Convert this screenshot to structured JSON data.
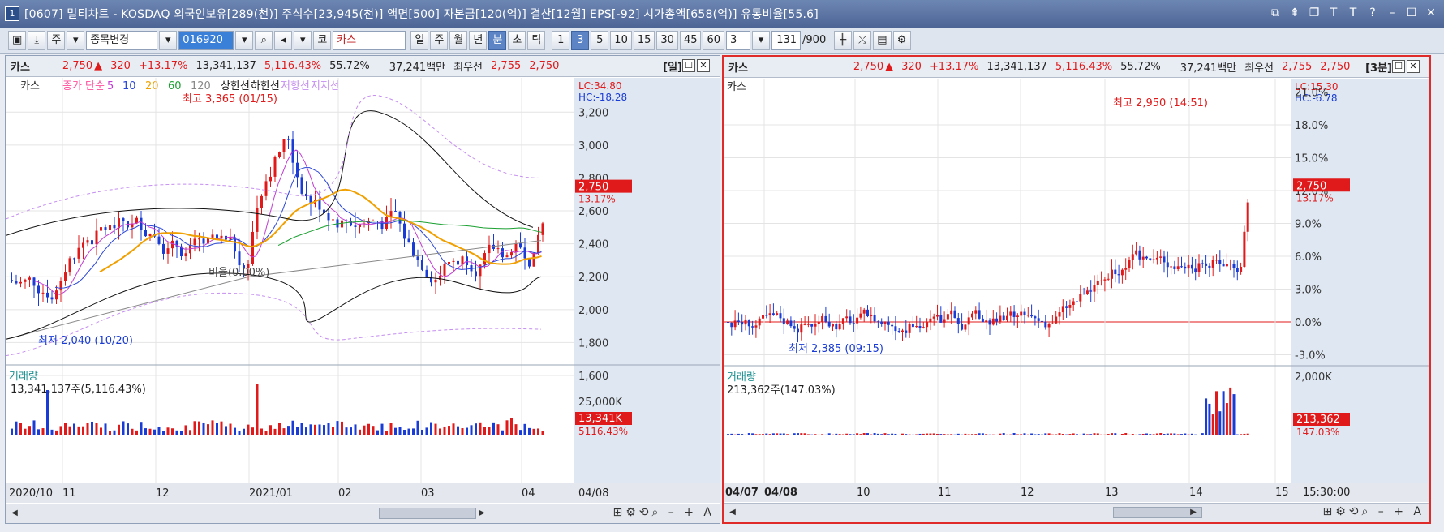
{
  "window": {
    "app_index": "1",
    "title": "[0607] 멀티차트 - KOSDAQ 외국인보유[289(천)] 주식수[23,945(천)] 액면[500] 자본금[120(억)] 결산[12월] EPS[-92] 시가총액[658(억)] 유통비율[55.6]"
  },
  "toolbar": {
    "market": "주",
    "stock_change": "종목변경",
    "code": "016920",
    "kor_btn": "코",
    "stock_name": "카스",
    "periods": [
      "일",
      "주",
      "월",
      "년",
      "분",
      "초",
      "틱"
    ],
    "active_period": "분",
    "intervals": [
      "1",
      "3",
      "5",
      "10",
      "15",
      "30",
      "45",
      "60"
    ],
    "active_interval": "3",
    "interval_value": "3",
    "count": "131",
    "count_max": "/900"
  },
  "left_panel": {
    "name": "카스",
    "price": "2,750",
    "change": "320",
    "change_pct": "+13.17%",
    "volume": "13,341,137",
    "volume_ratio": "5,116.43%",
    "rotation": "55.72%",
    "amount": "37,241백만",
    "best_label": "최우선",
    "ask": "2,755",
    "bid": "2,750",
    "period": "[일]",
    "legend_tag": "카스",
    "legend_items": [
      "종가 단순",
      "5",
      "10",
      "20",
      "60",
      "120",
      "상한선",
      "하한선",
      "저항선",
      "지지선"
    ],
    "lc": "LC:34.80",
    "hc": "HC:-18.28",
    "high_note": "최고 3,365 (01/15)",
    "low_note": "최저 2,040 (10/20)",
    "mid_note": "비율(0.00%)",
    "price_label": "2,750",
    "price_pct": "13.17%",
    "y_ticks": [
      "3,200",
      "3,000",
      "2,800",
      "2,600",
      "2,400",
      "2,200",
      "2,000",
      "1,800",
      "1,600"
    ],
    "volume_title": "거래량",
    "volume_text": "13,341,137주(5,116.43%)",
    "vol_ticks": [
      "25,000K"
    ],
    "vol_label": "13,341K",
    "vol_pct": "5116.43%",
    "x_labels": [
      "2020/10",
      "11",
      "12",
      "2021/01",
      "02",
      "03",
      "04",
      "04/08"
    ]
  },
  "right_panel": {
    "name": "카스",
    "price": "2,750",
    "change": "320",
    "change_pct": "+13.17%",
    "volume": "13,341,137",
    "volume_ratio": "5,116.43%",
    "rotation": "55.72%",
    "amount": "37,241백만",
    "best_label": "최우선",
    "ask": "2,755",
    "bid": "2,750",
    "period": "[3분]",
    "legend_tag": "카스",
    "lc": "LC:15.30",
    "hc": "HC:-6.78",
    "high_note": "최고 2,950 (14:51)",
    "low_note": "최저 2,385 (09:15)",
    "price_label": "2,750",
    "price_pct": "13.17%",
    "y_ticks": [
      "21.0%",
      "18.0%",
      "15.0%",
      "12.0%",
      "9.0%",
      "6.0%",
      "3.0%",
      "0.0%",
      "-3.0%"
    ],
    "volume_title": "거래량",
    "volume_text": "213,362주(147.03%)",
    "vol_ticks": [
      "2,000K"
    ],
    "vol_label": "213,362",
    "vol_pct": "147.03%",
    "x_labels": [
      "04/07",
      "04/08",
      "10",
      "11",
      "12",
      "13",
      "14",
      "15",
      "15:30:00"
    ]
  },
  "colors": {
    "up": "#e01a1a",
    "down": "#1a3cd6",
    "ma5": "#c23bd4",
    "ma10": "#2a46d8",
    "ma20": "#f0a000",
    "ma60": "#1aa030",
    "ma120": "#888888",
    "band": "#111111",
    "band_dash": "#c58ef0"
  }
}
